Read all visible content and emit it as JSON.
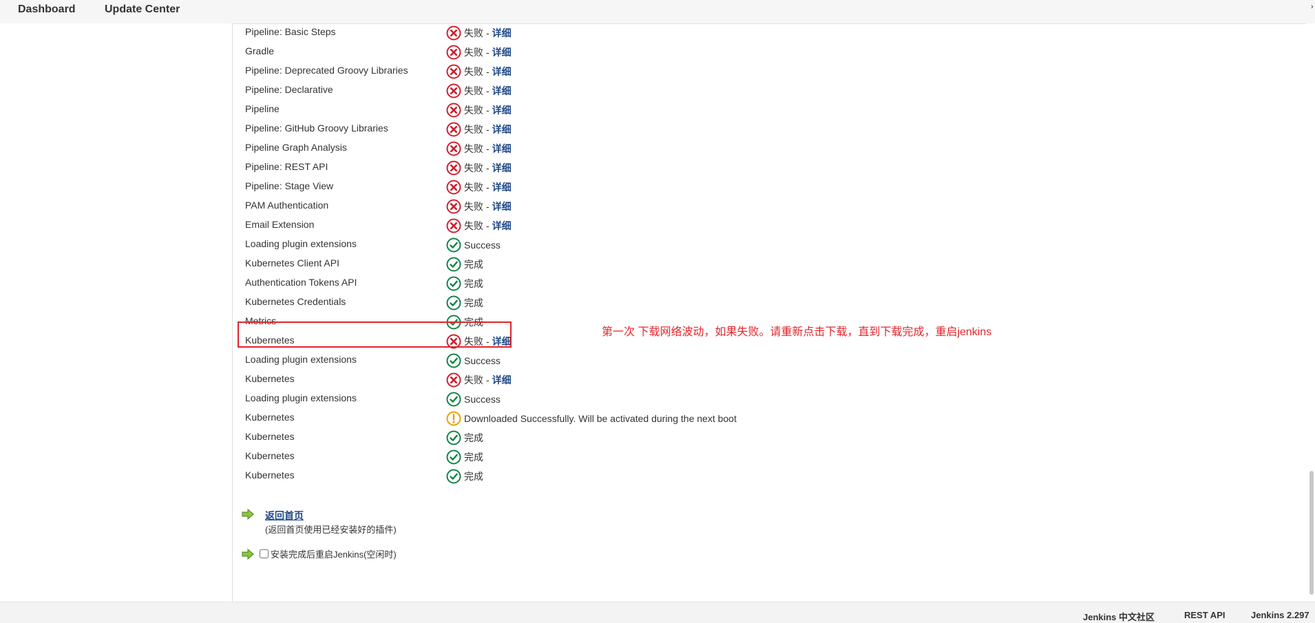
{
  "breadcrumbs": [
    "Dashboard",
    "Update Center"
  ],
  "rows": [
    {
      "name": "Pipeline: Basic Steps",
      "status": "fail",
      "text": "失败",
      "detail": "详细"
    },
    {
      "name": "Gradle",
      "status": "fail",
      "text": "失败",
      "detail": "详细"
    },
    {
      "name": "Pipeline: Deprecated Groovy Libraries",
      "status": "fail",
      "text": "失败",
      "detail": "详细"
    },
    {
      "name": "Pipeline: Declarative",
      "status": "fail",
      "text": "失败",
      "detail": "详细"
    },
    {
      "name": "Pipeline",
      "status": "fail",
      "text": "失败",
      "detail": "详细"
    },
    {
      "name": "Pipeline: GitHub Groovy Libraries",
      "status": "fail",
      "text": "失败",
      "detail": "详细"
    },
    {
      "name": "Pipeline Graph Analysis",
      "status": "fail",
      "text": "失败",
      "detail": "详细"
    },
    {
      "name": "Pipeline: REST API",
      "status": "fail",
      "text": "失败",
      "detail": "详细"
    },
    {
      "name": "Pipeline: Stage View",
      "status": "fail",
      "text": "失败",
      "detail": "详细"
    },
    {
      "name": "PAM Authentication",
      "status": "fail",
      "text": "失败",
      "detail": "详细"
    },
    {
      "name": "Email Extension",
      "status": "fail",
      "text": "失败",
      "detail": "详细"
    },
    {
      "name": "Loading plugin extensions",
      "status": "success",
      "text": "Success"
    },
    {
      "name": "Kubernetes Client API",
      "status": "success",
      "text": "完成"
    },
    {
      "name": "Authentication Tokens API",
      "status": "success",
      "text": "完成"
    },
    {
      "name": "Kubernetes Credentials",
      "status": "success",
      "text": "完成"
    },
    {
      "name": "Metrics",
      "status": "success",
      "text": "完成"
    },
    {
      "name": "Kubernetes",
      "status": "fail",
      "text": "失败",
      "detail": "详细"
    },
    {
      "name": "Loading plugin extensions",
      "status": "success",
      "text": "Success"
    },
    {
      "name": "Kubernetes",
      "status": "fail",
      "text": "失败",
      "detail": "详细"
    },
    {
      "name": "Loading plugin extensions",
      "status": "success",
      "text": "Success"
    },
    {
      "name": "Kubernetes",
      "status": "warning",
      "text": "Downloaded Successfully. Will be activated during the next boot"
    },
    {
      "name": "Kubernetes",
      "status": "success",
      "text": "完成"
    },
    {
      "name": "Kubernetes",
      "status": "success",
      "text": "完成"
    },
    {
      "name": "Kubernetes",
      "status": "success",
      "text": "完成"
    }
  ],
  "annotation": "第一次 下载网络波动，如果失败。请重新点击下载，直到下载完成，重启jenkins",
  "back": {
    "link": "返回首页",
    "note": "(返回首页使用已经安装好的插件)"
  },
  "restart": {
    "label": "安装完成后重启Jenkins(空闲时)",
    "checked": false
  },
  "footer": {
    "community": "Jenkins 中文社区",
    "rest_api": "REST API",
    "version": "Jenkins 2.297"
  },
  "colors": {
    "fail": "#d0202d",
    "success": "#138347",
    "warning": "#e8a100",
    "annotation": "#e4262c",
    "link": "#204a87"
  }
}
